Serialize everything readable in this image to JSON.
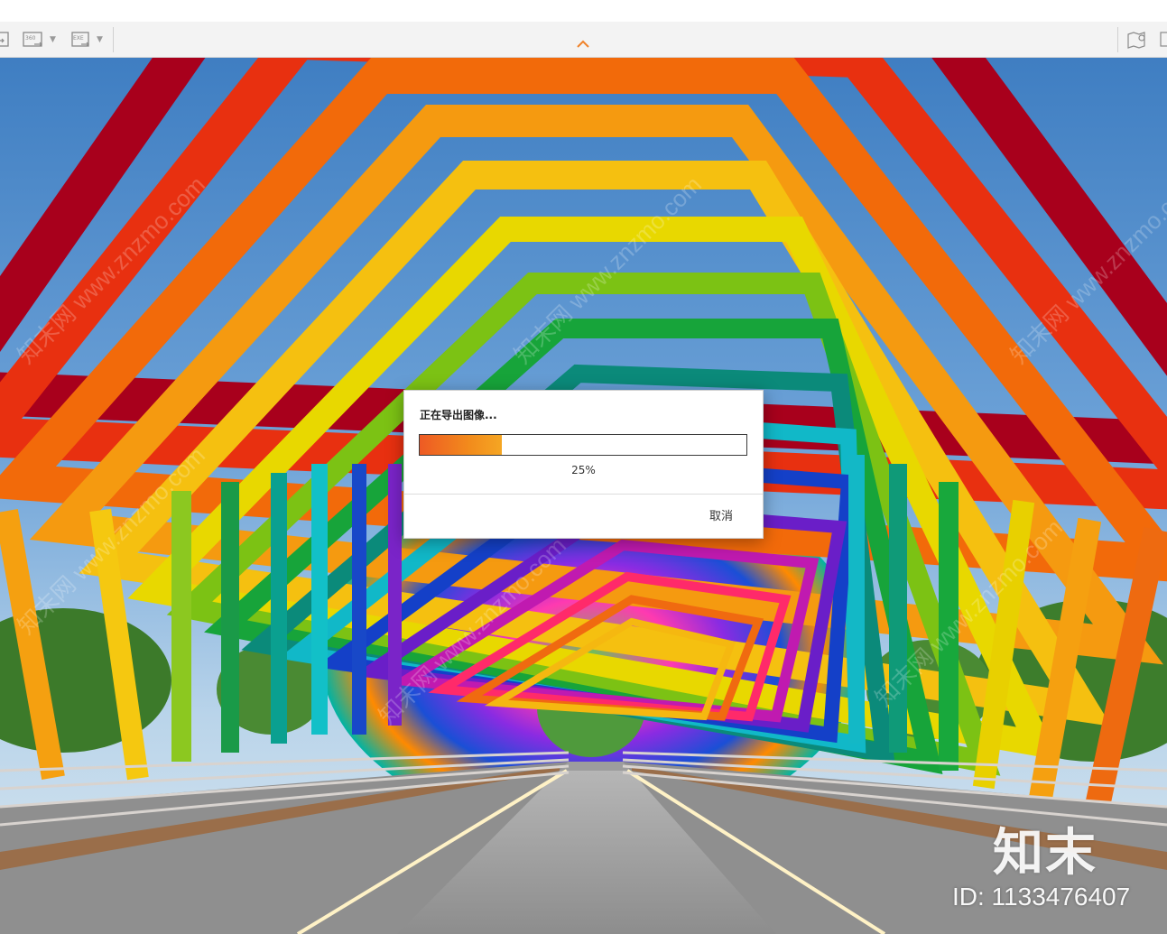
{
  "toolbar": {
    "buttons": [
      {
        "name": "export-2d-button",
        "icon": "image-export-icon"
      },
      {
        "name": "export-360-button",
        "icon": "panorama-360-icon",
        "icon_text": "360"
      },
      {
        "name": "export-exe-button",
        "icon": "exe-export-icon",
        "icon_text": "EXE"
      }
    ],
    "right_icons": [
      "map-pin-icon"
    ]
  },
  "dialog": {
    "title": "正在导出图像...",
    "progress_percent": 25,
    "progress_text": "25%",
    "cancel_label": "取消",
    "accent_color": "#f28b1c"
  },
  "watermark": {
    "logo_text": "知末",
    "id_text": "ID: 1133476407",
    "diagonal_text": "知末网 www.znzmo.com"
  }
}
